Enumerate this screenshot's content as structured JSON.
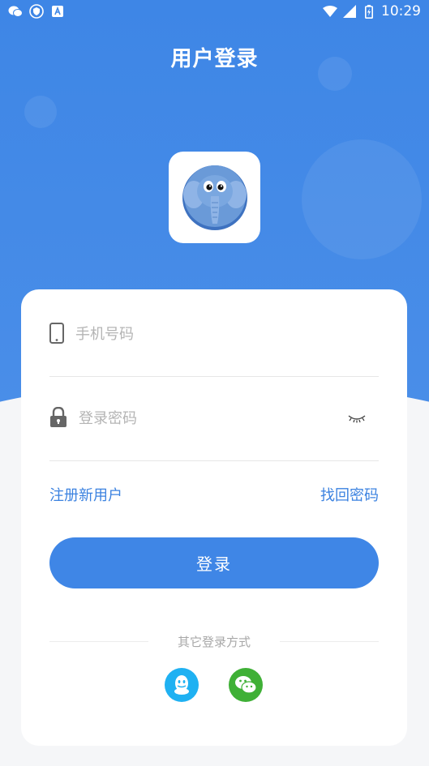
{
  "status_bar": {
    "time": "10:29"
  },
  "header": {
    "title": "用户登录"
  },
  "form": {
    "phone_placeholder": "手机号码",
    "password_placeholder": "登录密码",
    "register_label": "注册新用户",
    "forgot_label": "找回密码",
    "login_label": "登录"
  },
  "other_login": {
    "label": "其它登录方式"
  },
  "icons": {
    "phone": "phone-icon",
    "lock": "lock-icon",
    "eye": "eye-closed-icon",
    "qq": "qq-icon",
    "wechat": "wechat-icon"
  },
  "colors": {
    "primary": "#3f86e6",
    "link": "#3b82e0",
    "qq": "#1fb1f2",
    "wechat": "#3fb036"
  }
}
